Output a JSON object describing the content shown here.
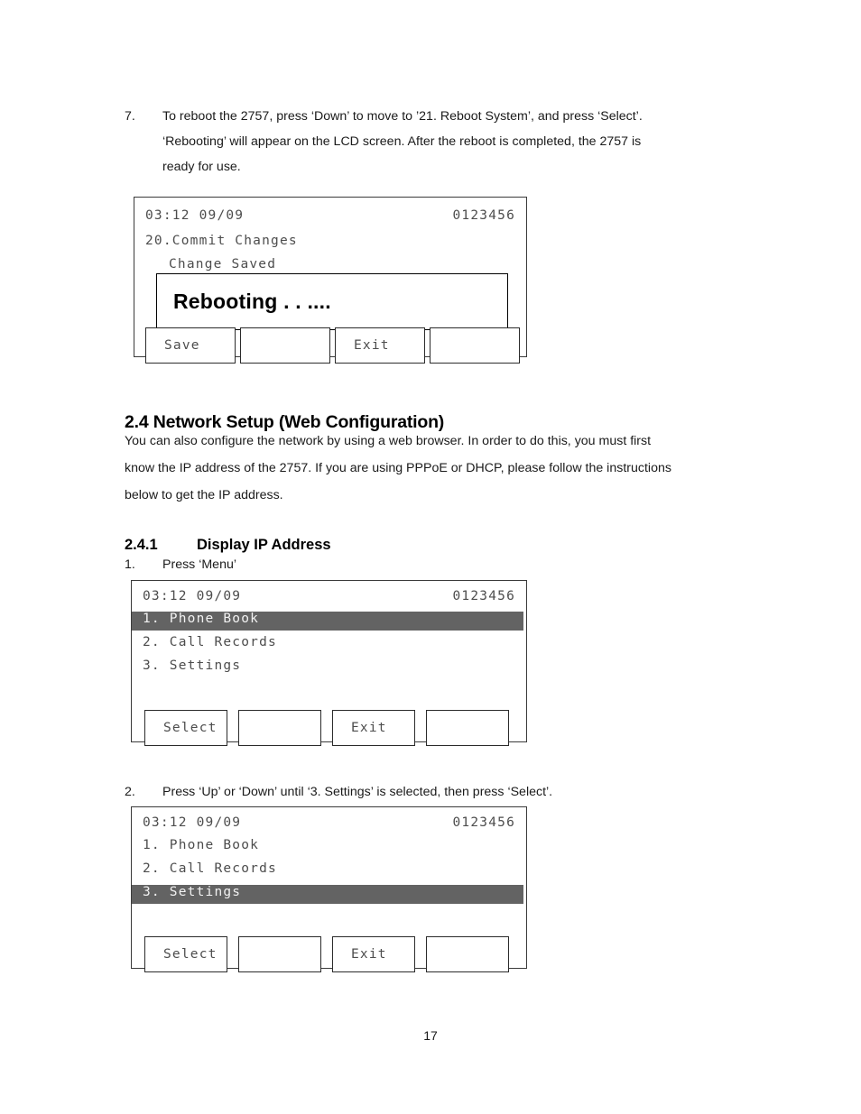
{
  "document": {
    "page_number": "17"
  },
  "step7": {
    "number": "7.",
    "line1": "To reboot the 2757, press ‘Down’ to move to ’21. Reboot System’, and press ‘Select’.",
    "line2": "‘Rebooting’ will appear on the LCD screen.    After the reboot is completed, the 2757 is",
    "line3": "ready for use."
  },
  "lcd1": {
    "status_time": "03:12 09/09",
    "status_id": "0123456",
    "menu_title": "20.Commit Changes",
    "message": "Change Saved",
    "popup_text": "Rebooting . . ....",
    "softkeys": [
      "Save",
      "",
      "Exit",
      ""
    ]
  },
  "section_2_4": {
    "heading": "2.4 Network Setup (Web Configuration)",
    "paragraph_line1": "You can also configure the network by using a web browser.    In order to do this, you must first",
    "paragraph_line2": "know the IP address of the 2757. If you are using PPPoE or DHCP, please follow the instructions",
    "paragraph_line3": "below to get the IP address."
  },
  "section_2_4_1": {
    "number": "2.4.1",
    "title": "Display IP Address"
  },
  "step1": {
    "number": "1.",
    "text": "Press ‘Menu’"
  },
  "lcd2": {
    "status_time": "03:12 09/09",
    "status_id": "0123456",
    "items": [
      {
        "label": "1. Phone Book",
        "selected": true
      },
      {
        "label": "2. Call Records",
        "selected": false
      },
      {
        "label": "3. Settings",
        "selected": false
      }
    ],
    "softkeys": [
      "Select",
      "",
      "Exit",
      ""
    ]
  },
  "step2": {
    "number": "2.",
    "text": "Press ‘Up’ or ‘Down’ until ‘3. Settings’ is selected, then press ‘Select’."
  },
  "lcd3": {
    "status_time": "03:12 09/09",
    "status_id": "0123456",
    "items": [
      {
        "label": "1. Phone Book",
        "selected": false
      },
      {
        "label": "2. Call Records",
        "selected": false
      },
      {
        "label": "3. Settings",
        "selected": true
      }
    ],
    "softkeys": [
      "Select",
      "",
      "Exit",
      ""
    ]
  },
  "colors": {
    "highlight": "#636363",
    "lcd_text": "#4d4d4d",
    "frame": "#3a3a3a"
  }
}
